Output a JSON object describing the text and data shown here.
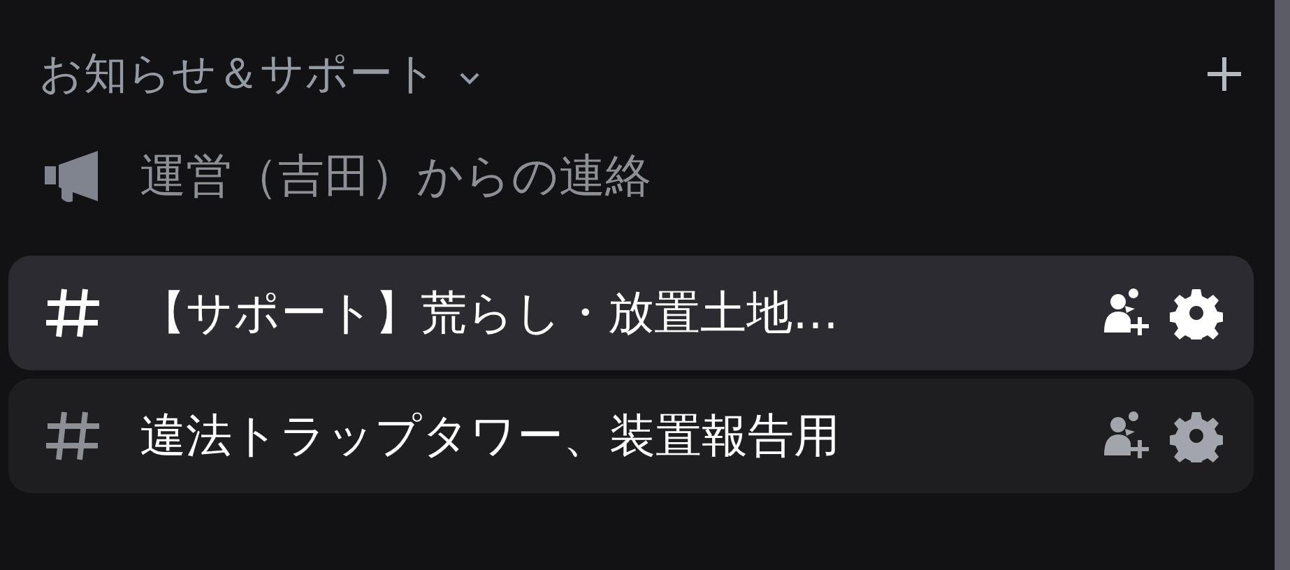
{
  "category": {
    "label": "お知らせ＆サポート",
    "expanded": true
  },
  "channels": [
    {
      "kind": "announcement",
      "name": "運営（吉田）からの連絡",
      "selected": false,
      "hovered": false,
      "unread": false
    },
    {
      "kind": "text",
      "name": "【サポート】荒らし・放置土地…",
      "selected": true,
      "hovered": false,
      "unread": true
    },
    {
      "kind": "text",
      "name": "違法トラップタワー、装置報告用",
      "selected": false,
      "hovered": true,
      "unread": true
    }
  ]
}
